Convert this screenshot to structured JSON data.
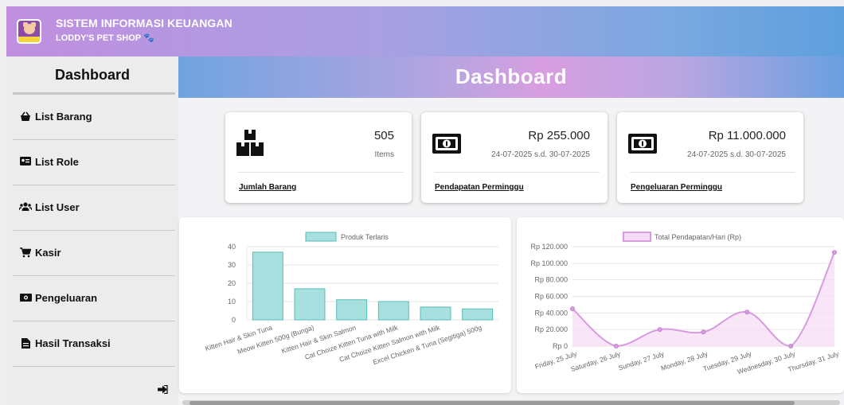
{
  "app": {
    "title": "SISTEM INFORMASI KEUANGAN",
    "subtitle": "LODDY'S PET SHOP 🐾"
  },
  "sidebar": {
    "title": "Dashboard",
    "items": [
      {
        "label": "List Barang",
        "icon": "basket-icon"
      },
      {
        "label": "List Role",
        "icon": "id-card-icon"
      },
      {
        "label": "List User",
        "icon": "users-icon"
      },
      {
        "label": "Kasir",
        "icon": "cart-icon"
      },
      {
        "label": "Pengeluaran",
        "icon": "money-bill-icon"
      },
      {
        "label": "Hasil Transaksi",
        "icon": "file-icon"
      }
    ]
  },
  "page": {
    "title": "Dashboard"
  },
  "cards": [
    {
      "value": "505",
      "sub": "Items",
      "link": "Jumlah Barang",
      "icon": "boxes-icon"
    },
    {
      "value": "Rp 255.000",
      "sub": "24-07-2025 s.d. 30-07-2025",
      "link": "Pendapatan Perminggu",
      "icon": "money-bill-icon"
    },
    {
      "value": "Rp 11.000.000",
      "sub": "24-07-2025 s.d. 30-07-2025",
      "link": "Pengeluaran Perminggu",
      "icon": "money-bill-icon"
    }
  ],
  "chart_data": [
    {
      "type": "bar",
      "categories": [
        "Kitten Hair & Skin Tuna",
        "Meow Kitten 500g (Bunga)",
        "Kitten Hair & Skin Salmon",
        "Cat Choize Kitten Tuna with Milk",
        "Cat Choize Kitten Salmon with Milk",
        "Excel Chicken & Tuna (Segitiga) 500g"
      ],
      "series": [
        {
          "name": "Produk Terlaris",
          "values": [
            37,
            17,
            11,
            10,
            7,
            6
          ]
        }
      ],
      "ylim": [
        0,
        40
      ],
      "yticks": [
        "0",
        "10",
        "20",
        "30",
        "40"
      ],
      "legend": "top",
      "grid": true,
      "color": "#a8e0df",
      "border_color": "#56bdb9"
    },
    {
      "type": "line",
      "categories": [
        "Friday, 25 July",
        "Saturday, 26 July",
        "Sunday, 27 July",
        "Monday, 28 July",
        "Tuesday, 29 July",
        "Wednesday, 30 July",
        "Thursday, 31 July"
      ],
      "series": [
        {
          "name": "Total Pendapatan/Hari (Rp)",
          "values": [
            45000,
            0,
            20000,
            17000,
            41000,
            0,
            113000
          ]
        }
      ],
      "ylim": [
        0,
        120000
      ],
      "yticks": [
        "Rp 0",
        "Rp 20.000",
        "Rp 40.000",
        "Rp 60.000",
        "Rp 80.000",
        "Rp 100.000",
        "Rp 120.000"
      ],
      "legend": "top",
      "grid": true,
      "color": "#d79be0",
      "fill_color": "#f5dcf6"
    }
  ]
}
